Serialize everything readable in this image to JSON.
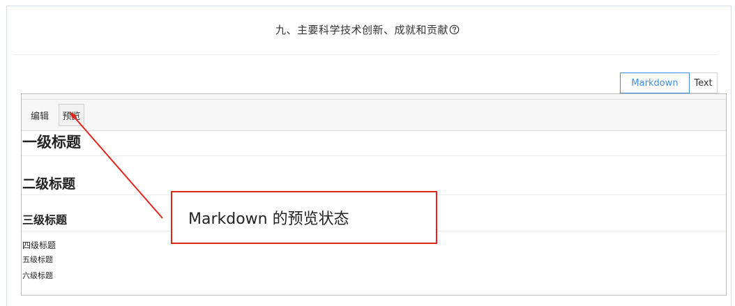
{
  "section": {
    "title": "九、主要科学技术创新、成就和贡献",
    "help_icon": "question-circle-icon"
  },
  "mode_tabs": [
    {
      "label": "Markdown",
      "active": true
    },
    {
      "label": "Text",
      "active": false
    }
  ],
  "toolbar": {
    "edit_label": "编辑",
    "preview_label": "预览"
  },
  "preview": {
    "h1": "一级标题",
    "h2": "二级标题",
    "h3": "三级标题",
    "h4": "四级标题",
    "h5": "五级标题",
    "h6": "六级标题"
  },
  "annotation": {
    "text": "Markdown 的预览状态",
    "color": "#e3231c"
  },
  "colors": {
    "accent": "#3f8de0",
    "annotation_red": "#e3231c"
  }
}
